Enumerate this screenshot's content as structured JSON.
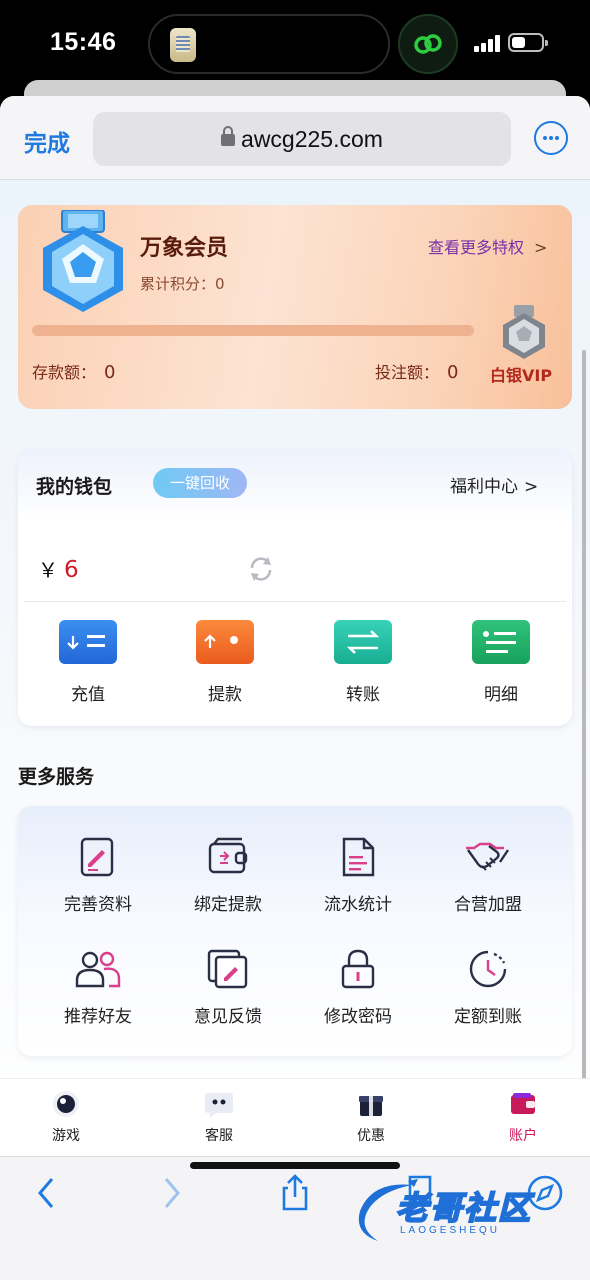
{
  "status_bar": {
    "time": "15:46"
  },
  "browser": {
    "done_label": "完成",
    "url": "awcg225.com"
  },
  "member": {
    "title": "万象会员",
    "points_label": "累计积分：",
    "points_value": "0",
    "privileges_label": "查看更多特权",
    "vip_progress_fraction": 0,
    "deposit_label": "存款额：",
    "deposit_value": "0",
    "bet_label": "投注额：",
    "bet_value": "0",
    "vip_level": "白银VIP"
  },
  "wallet": {
    "title": "我的钱包",
    "recycle_label": "一键回收",
    "welfare_label": "福利中心",
    "currency_symbol": "￥",
    "balance": "6",
    "actions": [
      {
        "label": "充值",
        "icon": "deposit-icon"
      },
      {
        "label": "提款",
        "icon": "withdraw-icon"
      },
      {
        "label": "转账",
        "icon": "transfer-icon"
      },
      {
        "label": "明细",
        "icon": "details-icon"
      }
    ]
  },
  "services": {
    "heading": "更多服务",
    "items": [
      {
        "label": "完善资料",
        "icon": "edit-profile-icon"
      },
      {
        "label": "绑定提款",
        "icon": "wallet-card-icon"
      },
      {
        "label": "流水统计",
        "icon": "document-icon"
      },
      {
        "label": "合营加盟",
        "icon": "handshake-icon"
      },
      {
        "label": "推荐好友",
        "icon": "friends-icon"
      },
      {
        "label": "意见反馈",
        "icon": "feedback-icon"
      },
      {
        "label": "修改密码",
        "icon": "lock-icon"
      },
      {
        "label": "定额到账",
        "icon": "clock-icon"
      }
    ]
  },
  "tabbar": {
    "items": [
      {
        "label": "游戏",
        "icon": "game-eye-icon"
      },
      {
        "label": "客服",
        "icon": "chat-bubble-icon"
      },
      {
        "label": "优惠",
        "icon": "gift-icon"
      },
      {
        "label": "账户",
        "icon": "wallet-icon"
      }
    ],
    "active_index": 3,
    "active_color": "#c8195a"
  },
  "watermark": {
    "title": "老哥社区",
    "subtitle": "LAOGESHEQU"
  }
}
